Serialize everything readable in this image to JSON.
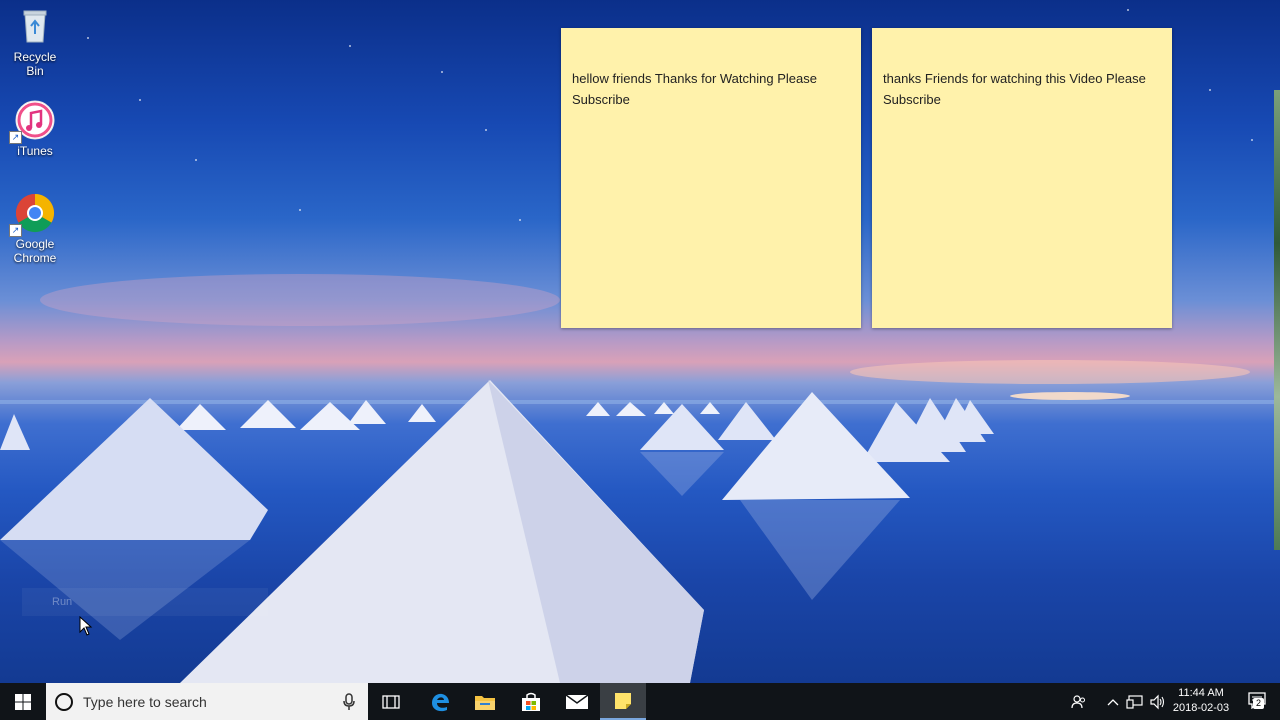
{
  "desktop": {
    "icons": [
      {
        "label": "Recycle Bin",
        "icon": "recycle-bin-icon",
        "shortcut": false
      },
      {
        "label": "iTunes",
        "icon": "itunes-icon",
        "shortcut": true
      },
      {
        "label": "Google Chrome",
        "icon": "chrome-icon",
        "shortcut": true
      }
    ],
    "run_hint": "Run"
  },
  "sticky_notes": [
    {
      "text": "hellow friends Thanks for Watching Please Subscribe"
    },
    {
      "text": "thanks Friends for watching this Video Please Subscribe"
    }
  ],
  "taskbar": {
    "search_placeholder": "Type here to search",
    "pinned": [
      {
        "name": "task-view-icon",
        "active": false
      },
      {
        "name": "edge-icon",
        "active": false
      },
      {
        "name": "file-explorer-icon",
        "active": false
      },
      {
        "name": "store-icon",
        "active": false
      },
      {
        "name": "mail-icon",
        "active": false
      },
      {
        "name": "sticky-notes-icon",
        "active": true
      }
    ],
    "tray": {
      "time": "11:44 AM",
      "date": "2018-02-03",
      "notification_count": "2"
    }
  },
  "colors": {
    "sticky_yellow": "#fff2ab",
    "taskbar_bg": "#101418",
    "accent": "#7aa7de"
  }
}
